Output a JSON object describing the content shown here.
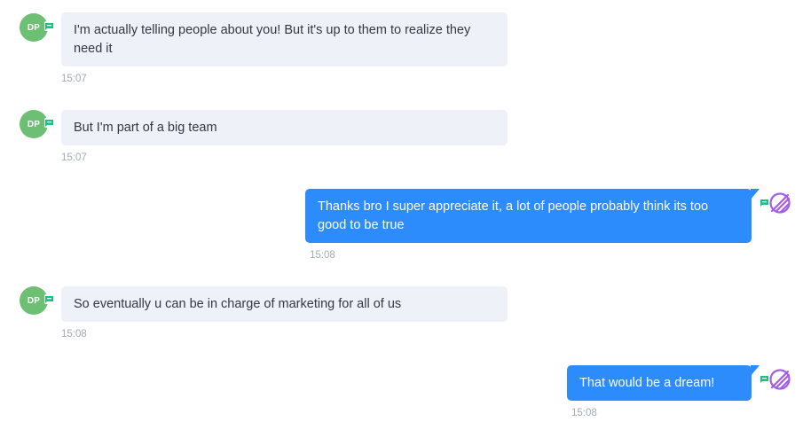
{
  "colors": {
    "incoming_bubble": "#eff1f8",
    "outgoing_bubble": "#2d8cfb",
    "avatar": "#6cbf73",
    "badge": "#16c47f",
    "bot_icon": "#a45de8",
    "timestamp": "#a3a9b4"
  },
  "messages": [
    {
      "direction": "incoming",
      "avatar_initials": "DP",
      "text": "I'm actually telling people about you! But it's up to them to realize they need it",
      "time": "15:07"
    },
    {
      "direction": "incoming",
      "avatar_initials": "DP",
      "text": "But I'm part of a big team",
      "time": "15:07"
    },
    {
      "direction": "outgoing",
      "avatar_icon": "bot-icon",
      "text": "Thanks bro I super appreciate it, a lot of people probably think its too good to be true",
      "time": "15:08"
    },
    {
      "direction": "incoming",
      "avatar_initials": "DP",
      "text": "So eventually u can be in charge of marketing for all of us",
      "time": "15:08"
    },
    {
      "direction": "outgoing",
      "avatar_icon": "bot-icon",
      "text": "That would be a dream!",
      "time": "15:08"
    }
  ]
}
